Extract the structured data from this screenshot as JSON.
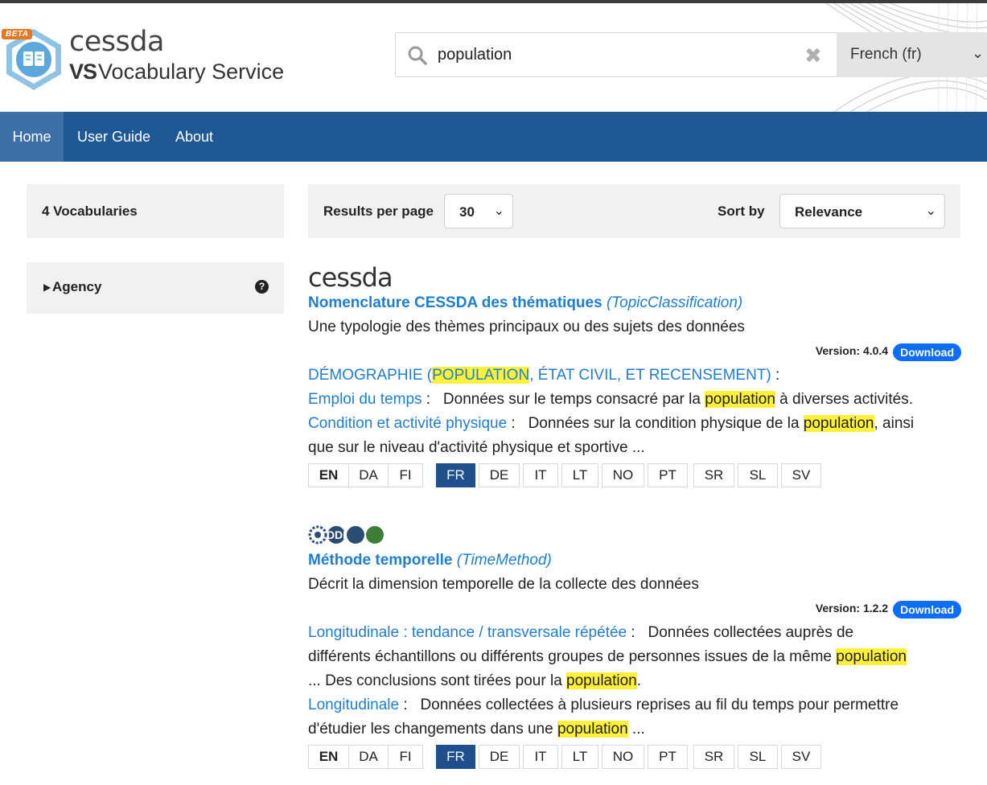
{
  "header": {
    "beta_badge": "BETA",
    "brand_top": "cessda",
    "brand_vs": "VS",
    "brand_bottom": "Vocabulary Service",
    "search": {
      "value": "population",
      "placeholder": ""
    },
    "language_select": {
      "selected": "French (fr)"
    }
  },
  "nav": {
    "items": [
      {
        "label": "Home"
      },
      {
        "label": "User Guide"
      },
      {
        "label": "About"
      }
    ]
  },
  "sidebar": {
    "count_label": "4 Vocabularies",
    "facet_label": "Agency",
    "help_glyph": "?"
  },
  "toolbar": {
    "results_per_page_label": "Results per page",
    "results_per_page_value": "30",
    "sort_by_label": "Sort by",
    "sort_by_value": "Relevance"
  },
  "results": [
    {
      "agency_logo": "cessda",
      "title": "Nomenclature CESSDA des thématiques",
      "notation": "(TopicClassification)",
      "description": "Une typologie des thèmes principaux ou des sujets des données",
      "version_label": "Version: 4.0.4",
      "download_label": "Download",
      "lines": [
        {
          "term": "DÉMOGRAPHIE (",
          "term_hl": "POPULATION",
          "term_end": ", ÉTAT CIVIL, ET RECENSEMENT)",
          "sep": " :"
        },
        {
          "term": "Emploi du temps",
          "sep": " :   ",
          "t1": "Données sur le temps consacré par la ",
          "hl": "population",
          "t2": " à diverses activités."
        },
        {
          "term": "Condition et activité physique",
          "sep": " :   ",
          "t1": "Données sur la condition physique de la ",
          "hl": "population",
          "t2": ", ainsi",
          "t3": "que sur le niveau d'activité physique et sportive ..."
        }
      ],
      "languages": [
        "EN",
        "DA",
        "FI",
        "FR",
        "DE",
        "IT",
        "LT",
        "NO",
        "PT",
        "SR",
        "SL",
        "SV"
      ]
    },
    {
      "agency_logo": "DDI",
      "title": "Méthode temporelle",
      "notation": "(TimeMethod)",
      "description": "Décrit la dimension temporelle de la collecte des données",
      "version_label": "Version: 1.2.2",
      "download_label": "Download",
      "lines": [
        {
          "term": "Longitudinale : tendance / transversale répétée",
          "sep": " :   ",
          "t1": "Données collectées auprès de",
          "t2": "différents échantillons ou différents groupes de personnes issues de la même ",
          "hl": "population",
          "t3": "... Des conclusions sont tirées pour la ",
          "hl2": "population",
          "t4": "."
        },
        {
          "term": "Longitudinale",
          "sep": " :   ",
          "t1": "Données collectées à plusieurs reprises au fil du temps pour permettre",
          "t2": "d'étudier les changements dans une ",
          "hl": "population",
          "t3": " ..."
        }
      ],
      "languages": [
        "EN",
        "DA",
        "FI",
        "FR",
        "DE",
        "IT",
        "LT",
        "NO",
        "PT",
        "SR",
        "SL",
        "SV"
      ]
    }
  ]
}
